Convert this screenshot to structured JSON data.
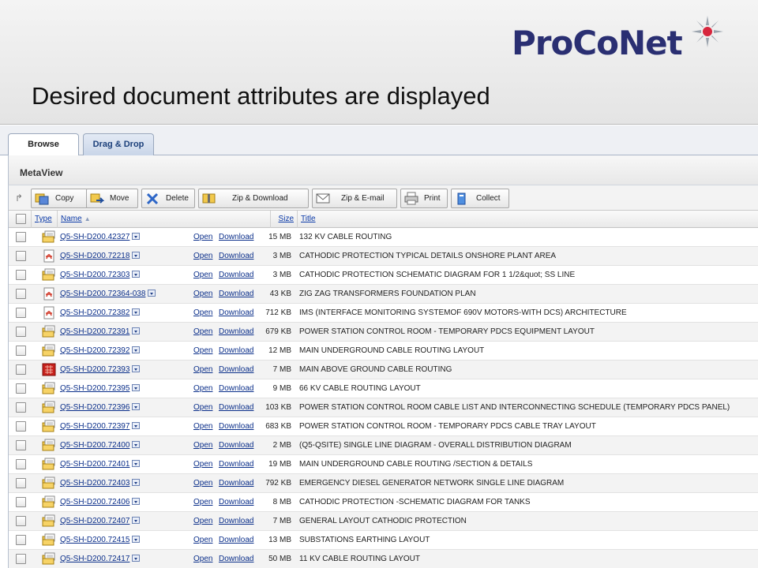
{
  "slide": {
    "title": "Desired document attributes are displayed",
    "logo_text": "ProCoNet"
  },
  "tabs": [
    {
      "label": "Browse"
    },
    {
      "label": "Drag & Drop"
    }
  ],
  "panel": {
    "title": "MetaView"
  },
  "toolbar": {
    "copy": "Copy",
    "move": "Move",
    "delete": "Delete",
    "zip_download": "Zip & Download",
    "zip_email": "Zip & E-mail",
    "print": "Print",
    "collect": "Collect"
  },
  "columns": {
    "type": "Type",
    "name": "Name",
    "size": "Size",
    "title": "Title"
  },
  "link_labels": {
    "open": "Open",
    "download": "Download"
  },
  "rows": [
    {
      "type": "folder",
      "name": "Q5-SH-D200.42327",
      "size": "15 MB",
      "title": "132 KV CABLE ROUTING"
    },
    {
      "type": "pdf",
      "name": "Q5-SH-D200.72218",
      "size": "3 MB",
      "title": "CATHODIC PROTECTION TYPICAL DETAILS ONSHORE PLANT AREA"
    },
    {
      "type": "folder",
      "name": "Q5-SH-D200.72303",
      "size": "3 MB",
      "title": "CATHODIC PROTECTION SCHEMATIC DIAGRAM FOR 1 1/2&quot; SS LINE"
    },
    {
      "type": "pdf",
      "name": "Q5-SH-D200.72364-038",
      "size": "43 KB",
      "title": "ZIG ZAG TRANSFORMERS FOUNDATION PLAN"
    },
    {
      "type": "pdf",
      "name": "Q5-SH-D200.72382",
      "size": "712 KB",
      "title": "IMS (INTERFACE MONITORING SYSTEMOF 690V MOTORS-WITH DCS) ARCHITECTURE"
    },
    {
      "type": "folder",
      "name": "Q5-SH-D200.72391",
      "size": "679 KB",
      "title": "POWER STATION CONTROL ROOM - TEMPORARY PDCS EQUIPMENT LAYOUT"
    },
    {
      "type": "folder",
      "name": "Q5-SH-D200.72392",
      "size": "12 MB",
      "title": "MAIN UNDERGROUND CABLE ROUTING LAYOUT"
    },
    {
      "type": "cad",
      "name": "Q5-SH-D200.72393",
      "size": "7 MB",
      "title": "MAIN ABOVE GROUND CABLE ROUTING"
    },
    {
      "type": "folder",
      "name": "Q5-SH-D200.72395",
      "size": "9 MB",
      "title": "66 KV CABLE ROUTING LAYOUT"
    },
    {
      "type": "folder",
      "name": "Q5-SH-D200.72396",
      "size": "103 KB",
      "title": "POWER STATION CONTROL ROOM CABLE LIST AND INTERCONNECTING SCHEDULE (TEMPORARY PDCS PANEL)"
    },
    {
      "type": "folder",
      "name": "Q5-SH-D200.72397",
      "size": "683 KB",
      "title": "POWER STATION CONTROL ROOM - TEMPORARY PDCS CABLE TRAY LAYOUT"
    },
    {
      "type": "folder",
      "name": "Q5-SH-D200.72400",
      "size": "2 MB",
      "title": "(Q5-QSITE) SINGLE LINE DIAGRAM - OVERALL DISTRIBUTION DIAGRAM"
    },
    {
      "type": "folder",
      "name": "Q5-SH-D200.72401",
      "size": "19 MB",
      "title": "MAIN UNDERGROUND CABLE ROUTING /SECTION & DETAILS"
    },
    {
      "type": "folder",
      "name": "Q5-SH-D200.72403",
      "size": "792 KB",
      "title": "EMERGENCY DIESEL GENERATOR NETWORK SINGLE LINE DIAGRAM"
    },
    {
      "type": "folder",
      "name": "Q5-SH-D200.72406",
      "size": "8 MB",
      "title": "CATHODIC PROTECTION -SCHEMATIC DIAGRAM FOR TANKS"
    },
    {
      "type": "folder",
      "name": "Q5-SH-D200.72407",
      "size": "7 MB",
      "title": "GENERAL LAYOUT CATHODIC PROTECTION"
    },
    {
      "type": "folder",
      "name": "Q5-SH-D200.72415",
      "size": "13 MB",
      "title": "SUBSTATIONS EARTHING LAYOUT"
    },
    {
      "type": "folder",
      "name": "Q5-SH-D200.72417",
      "size": "50 MB",
      "title": "11 KV CABLE ROUTING LAYOUT"
    }
  ],
  "colors": {
    "link": "#0b2f8a",
    "brand": "#2a2f72",
    "brand_dot": "#d7263d"
  }
}
